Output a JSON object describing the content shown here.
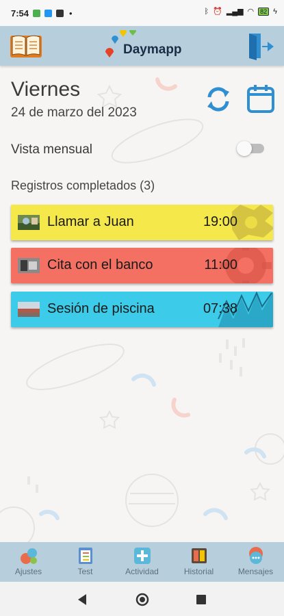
{
  "status_bar": {
    "time": "7:54",
    "battery": "82"
  },
  "app_bar": {
    "logo_text": "Daymapp"
  },
  "header": {
    "day": "Viernes",
    "date": "24 de marzo del 2023"
  },
  "monthly_view": {
    "label": "Vista mensual",
    "enabled": false
  },
  "records": {
    "title": "Registros completados (3)",
    "items": [
      {
        "title": "Llamar a Juan",
        "time": "19:00",
        "color": "#f5e84a"
      },
      {
        "title": "Cita con el banco",
        "time": "11:00",
        "color": "#f37063"
      },
      {
        "title": "Sesión de piscina",
        "time": "07:38",
        "color": "#3ccbe8"
      }
    ]
  },
  "bottom_nav": {
    "items": [
      {
        "label": "Ajustes",
        "icon": "settings-bubbles-icon"
      },
      {
        "label": "Test",
        "icon": "checklist-icon"
      },
      {
        "label": "Actividad",
        "icon": "plus-icon"
      },
      {
        "label": "Historial",
        "icon": "history-icon"
      },
      {
        "label": "Mensajes",
        "icon": "chat-icon"
      }
    ]
  },
  "colors": {
    "app_bar": "#b7cfdd",
    "accent_blue": "#2f8fd0",
    "background": "#f7f5f4"
  }
}
